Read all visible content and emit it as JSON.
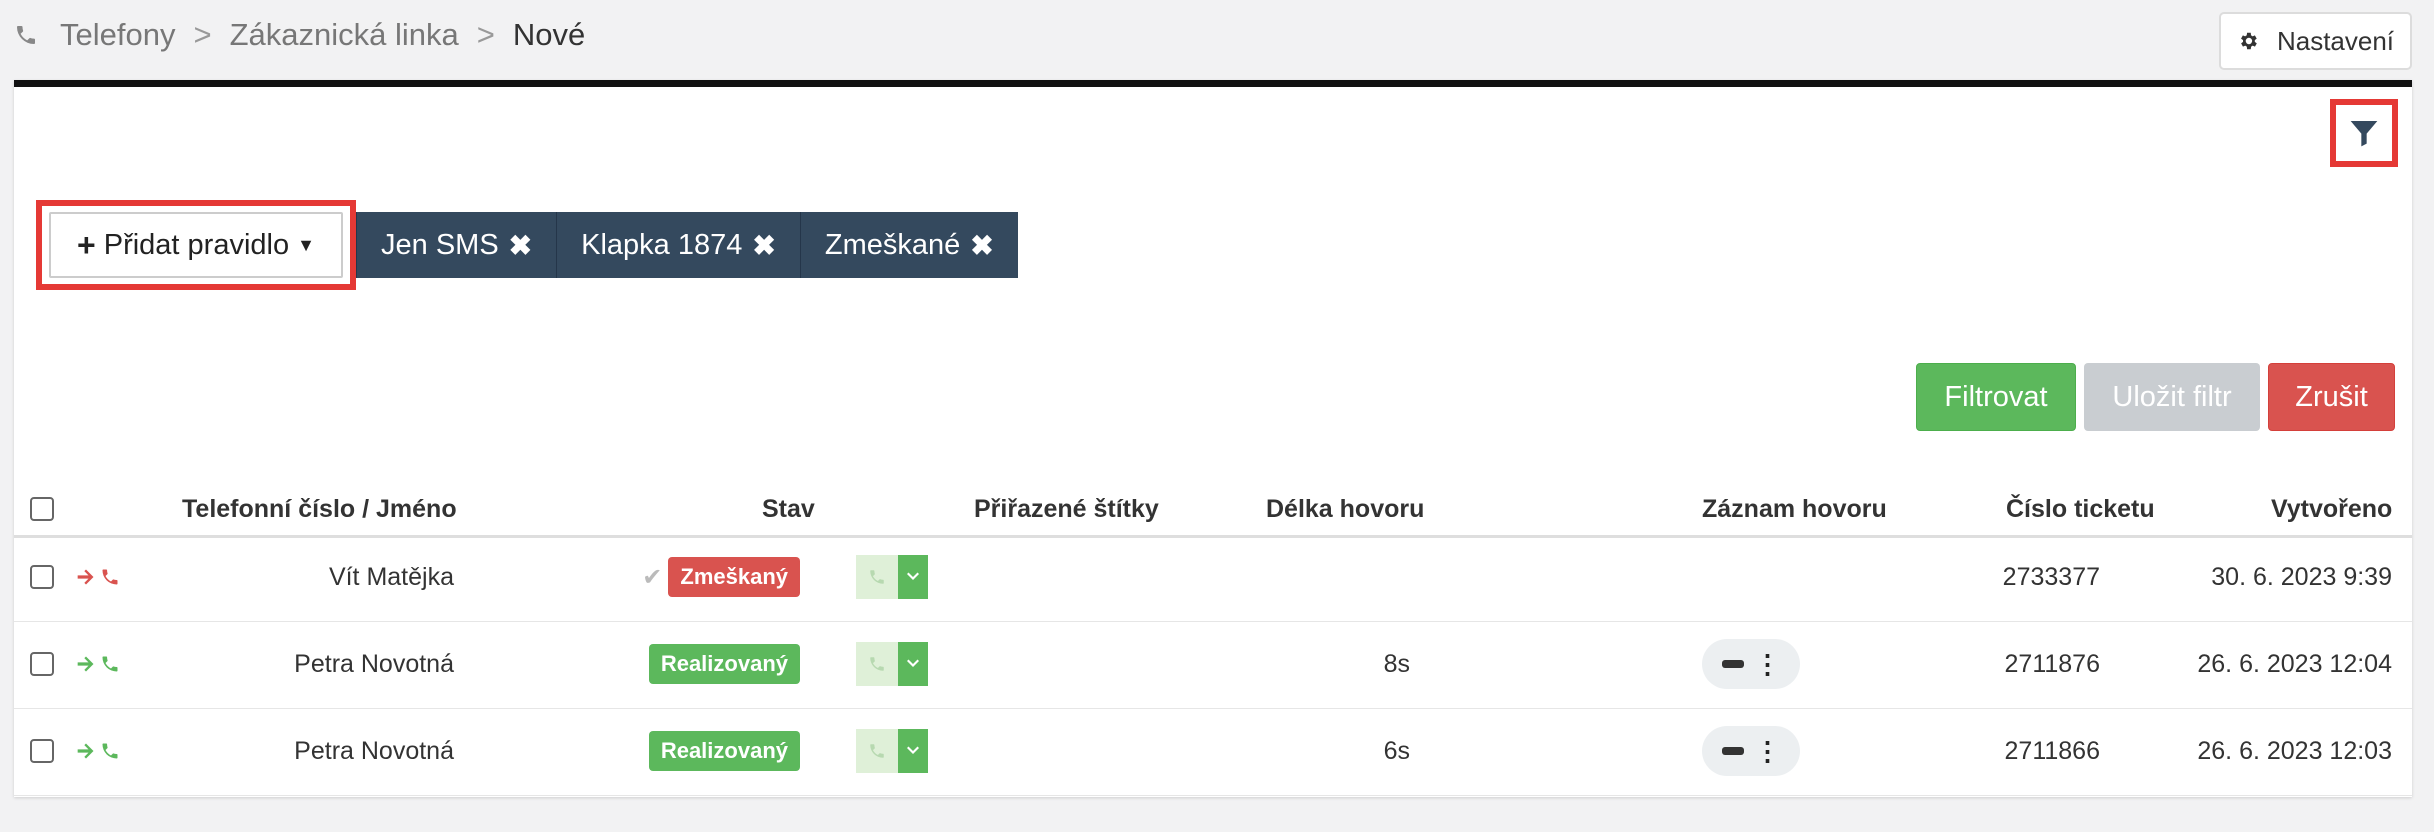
{
  "breadcrumb": {
    "items": [
      "Telefony",
      "Zákaznická linka"
    ],
    "separator": ">",
    "current": "Nové"
  },
  "settings_label": "Nastavení",
  "filter": {
    "add_rule_label": "Přidat pravidlo",
    "tags": [
      {
        "label": "Jen SMS"
      },
      {
        "label": "Klapka 1874"
      },
      {
        "label": "Zmeškané"
      }
    ],
    "actions": {
      "filter": "Filtrovat",
      "save": "Uložit filtr",
      "cancel": "Zrušit"
    }
  },
  "table": {
    "headers": {
      "phone_name": "Telefonní číslo / Jméno",
      "status": "Stav",
      "tags": "Přiřazené štítky",
      "duration": "Délka hovoru",
      "recording": "Záznam hovoru",
      "ticket": "Číslo ticketu",
      "created": "Vytvořeno"
    },
    "rows": [
      {
        "name": "Vít Matějka",
        "status": "Zmeškaný",
        "status_type": "missed",
        "direction_color": "#d9534f",
        "duration": "",
        "has_recording": false,
        "ticket": "2733377",
        "created": "30. 6. 2023 9:39"
      },
      {
        "name": "Petra Novotná",
        "status": "Realizovaný",
        "status_type": "done",
        "direction_color": "#5cb85c",
        "duration": "8s",
        "has_recording": true,
        "ticket": "2711876",
        "created": "26. 6. 2023 12:04"
      },
      {
        "name": "Petra Novotná",
        "status": "Realizovaný",
        "status_type": "done",
        "direction_color": "#5cb85c",
        "duration": "6s",
        "has_recording": true,
        "ticket": "2711866",
        "created": "26. 6. 2023 12:03"
      }
    ]
  },
  "colors": {
    "accent_red": "#e53935",
    "tag_bg": "#34495e",
    "green": "#5cb85c",
    "red": "#d9534f"
  }
}
